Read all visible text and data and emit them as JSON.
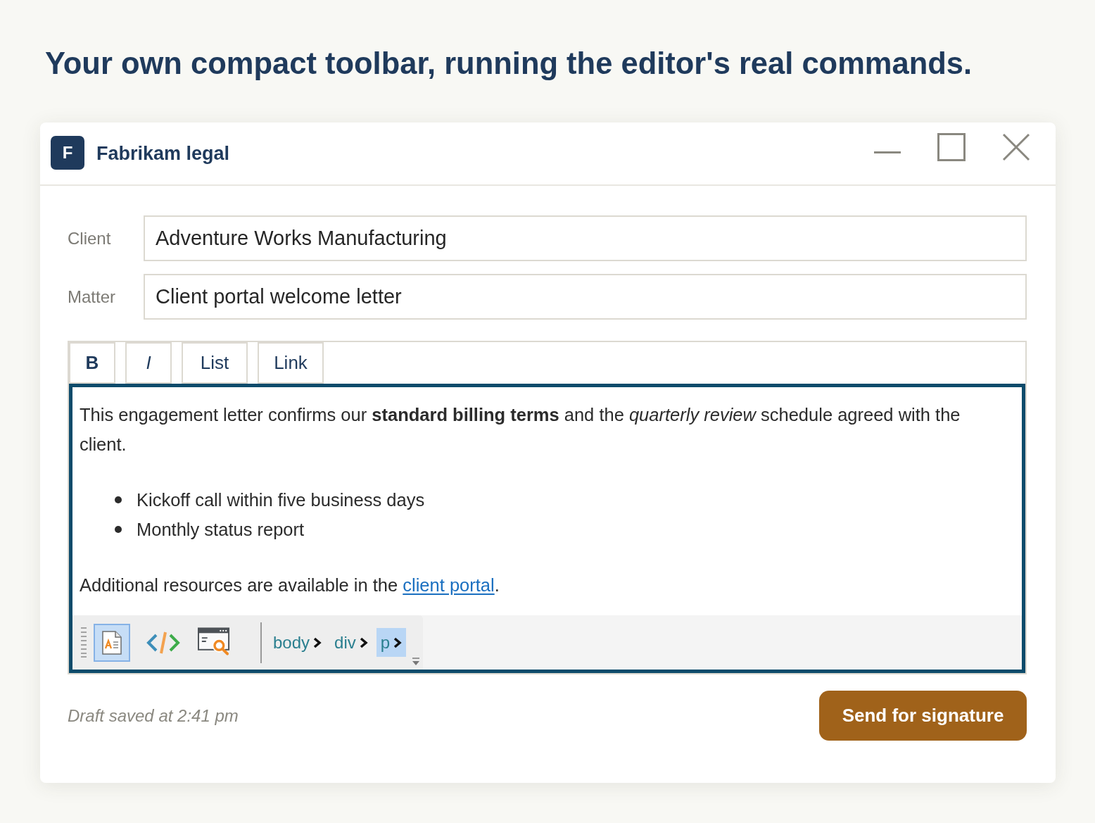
{
  "heading": "Your own compact toolbar, running the editor's real commands.",
  "window": {
    "logo": "F",
    "title": "Fabrikam legal"
  },
  "fields": [
    {
      "label": "Client",
      "value": "Adventure Works Manufacturing"
    },
    {
      "label": "Matter",
      "value": "Client portal welcome letter"
    }
  ],
  "editor": {
    "focused": true,
    "toolbar": [
      {
        "label": "B",
        "kind": "bold"
      },
      {
        "label": "I",
        "kind": "italic"
      },
      {
        "label": "List",
        "kind": "list"
      },
      {
        "label": "Link",
        "kind": "link"
      }
    ],
    "content": [
      {
        "kind": "paragraph",
        "text": "This engagement letter confirms our **standard billing terms** and the *quarterly review* schedule agreed with the client."
      },
      {
        "kind": "bullets",
        "items": [
          "Kickoff call within five business days",
          "Monthly status report"
        ]
      },
      {
        "kind": "paragraph",
        "text": "Additional resources are available in the ",
        "link": "client portal",
        "text_after": "."
      }
    ],
    "status_bar": {
      "modes": [
        {
          "kind": "design",
          "selected": true
        },
        {
          "kind": "source",
          "selected": false
        },
        {
          "kind": "preview",
          "selected": false
        }
      ],
      "path": [
        {
          "tag": "body",
          "selected": false
        },
        {
          "tag": "div",
          "selected": false
        },
        {
          "tag": "p",
          "selected": true
        }
      ]
    }
  },
  "footer": {
    "note": "Draft saved at 2:41 pm",
    "button": "Send for signature"
  }
}
